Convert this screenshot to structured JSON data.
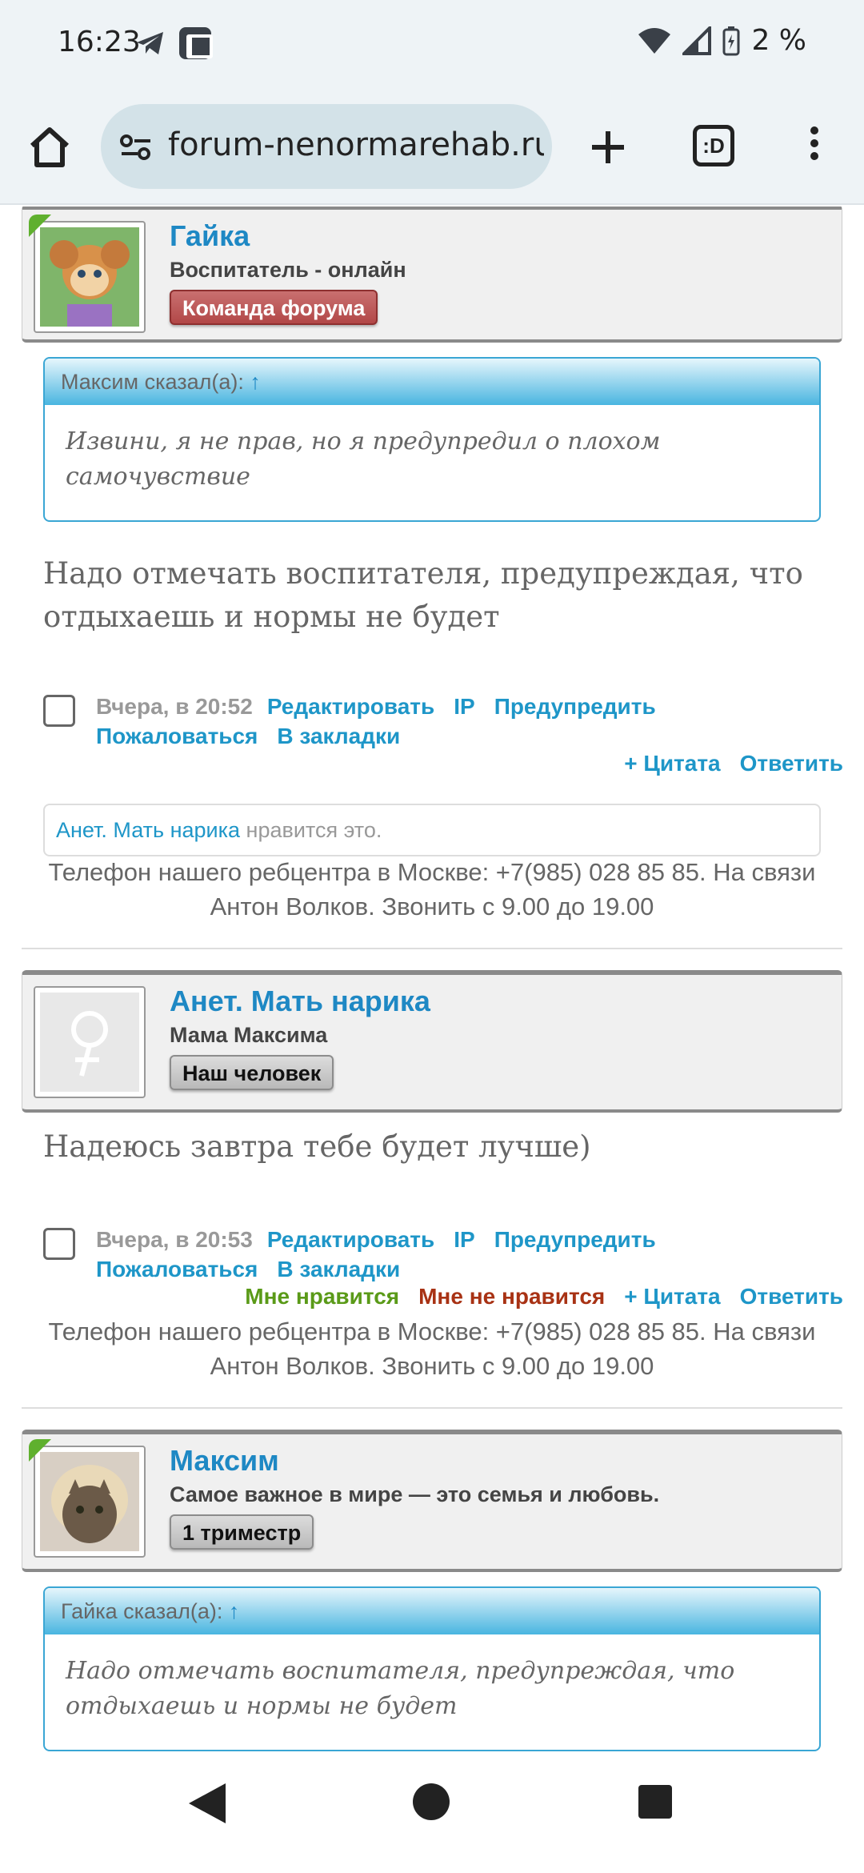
{
  "status": {
    "time": "16:23",
    "battery": "2 %"
  },
  "browser": {
    "url": "forum-nenormarehab.ru",
    "tabs_label": ":D"
  },
  "posts": [
    {
      "author": "Гайка",
      "role": "Воспитатель - онлайн",
      "badge": "Команда форума",
      "quote": {
        "header": "Максим сказал(а):",
        "arrow": "↑",
        "text": "Извини, я не прав, но я предупредил о плохом самочувствие"
      },
      "text": "Надо отмечать воспитателя, предупреждая, что отдыхаешь и нормы не будет",
      "date": "Вчера, в 20:52",
      "actions": [
        "Редактировать",
        "IP",
        "Предупредить",
        "Пожаловаться",
        "В закладки"
      ],
      "actions2": [
        "+ Цитата",
        "Ответить"
      ],
      "likes": {
        "who": "Анет. Мать нарика",
        "rest": "нравится это."
      },
      "signature": "Телефон нашего ребцентра в Москве: +7(985) 028 85 85. На связи Антон Волков. Звонить с 9.00 до 19.00"
    },
    {
      "author": "Анет. Мать нарика",
      "role": "Мама Максима",
      "badge": "Наш человек",
      "text": "Надеюсь завтра тебе будет лучше)",
      "date": "Вчера, в 20:53",
      "actions": [
        "Редактировать",
        "IP",
        "Предупредить",
        "Пожаловаться",
        "В закладки"
      ],
      "actions2": [
        "Мне нравится",
        "Мне не нравится",
        "+ Цитата",
        "Ответить"
      ],
      "signature": "Телефон нашего ребцентра в Москве: +7(985) 028 85 85. На связи Антон Волков. Звонить с 9.00 до 19.00"
    },
    {
      "author": "Максим",
      "role": "Самое важное в мире — это семья и любовь.",
      "badge": "1 триместр",
      "quote": {
        "header": "Гайка сказал(а):",
        "arrow": "↑",
        "text": "Надо отмечать воспитателя, предупреждая, что отдыхаешь и нормы не будет"
      }
    }
  ],
  "colors": {
    "link": "#1e96c8",
    "quote_border": "#3aa6d4",
    "badge_red": "#b24848",
    "like_green": "#5a9a18",
    "dislike_red": "#a83214"
  }
}
